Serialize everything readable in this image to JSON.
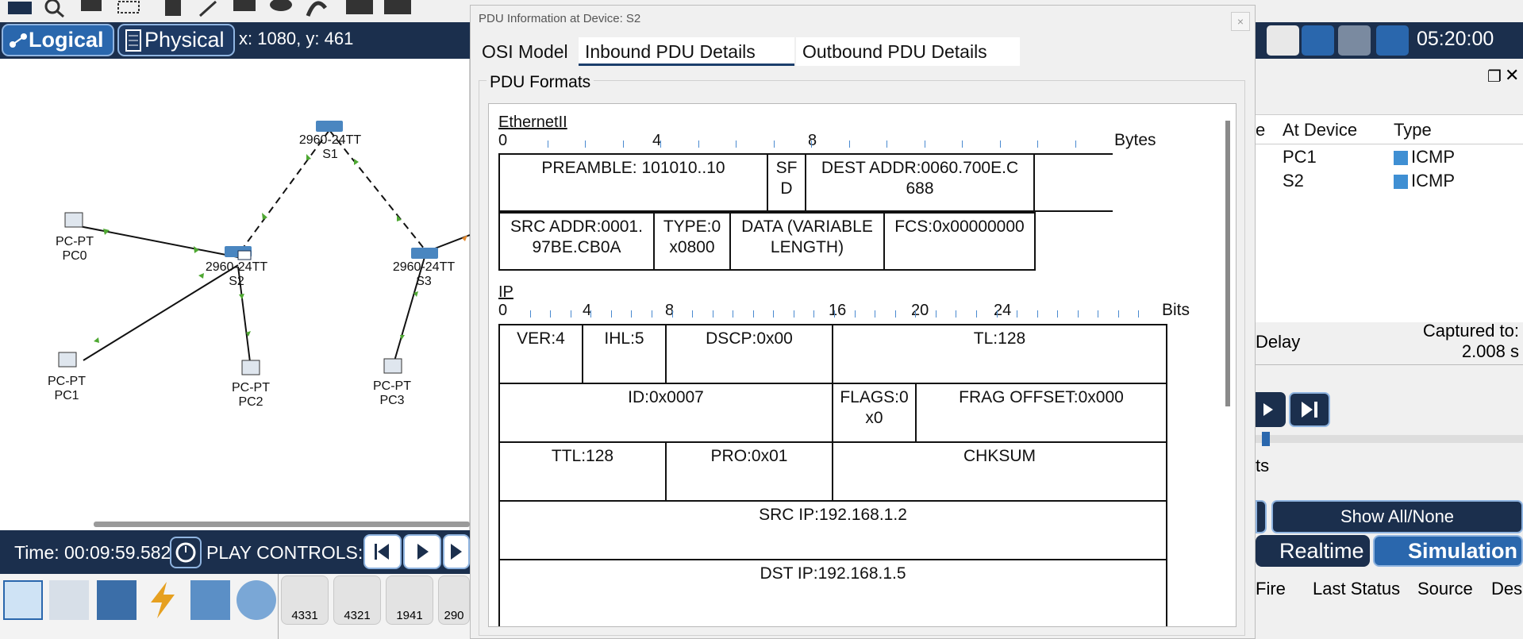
{
  "topbar": {
    "logical_label": "Logical",
    "physical_label": "Physical",
    "coords": "x: 1080, y: 461",
    "clock": "05:20:00"
  },
  "topology": {
    "devices": [
      {
        "model": "2960-24TT",
        "name": "S1"
      },
      {
        "model": "2960-24TT",
        "name": "S2"
      },
      {
        "model": "2960-24TT",
        "name": "S3"
      },
      {
        "model": "PC-PT",
        "name": "PC0"
      },
      {
        "model": "PC-PT",
        "name": "PC1"
      },
      {
        "model": "PC-PT",
        "name": "PC2"
      },
      {
        "model": "PC-PT",
        "name": "PC3"
      }
    ]
  },
  "bottom": {
    "time": "Time: 00:09:59.582",
    "play_controls": "PLAY CONTROLS:",
    "device_tiles": [
      "4331",
      "4321",
      "1941",
      "290"
    ]
  },
  "event_panel": {
    "headers": {
      "partial": "e",
      "at_device": "At Device",
      "type": "Type"
    },
    "rows": [
      {
        "at_device": "PC1",
        "type": "ICMP"
      },
      {
        "at_device": "S2",
        "type": "ICMP"
      }
    ],
    "delay_label": "Delay",
    "captured_label": "Captured to:",
    "captured_value": "2.008 s",
    "events_partial": "ts",
    "show_all_label": "Show All/None",
    "realtime_label": "Realtime",
    "simulation_label": "Simulation",
    "table_headers": [
      "Fire",
      "Last Status",
      "Source",
      "Des"
    ],
    "accent": "#3f8fd3"
  },
  "dialog": {
    "title": "PDU Information at Device: S2",
    "close": "×",
    "tabs": [
      "OSI Model",
      "Inbound PDU Details",
      "Outbound PDU Details"
    ],
    "group_label": "PDU Formats",
    "ethernet": {
      "title": "EthernetII",
      "scale": [
        "0",
        "4",
        "8"
      ],
      "unit": "Bytes",
      "fields": {
        "preamble": "PREAMBLE: 101010..10",
        "sfd": "SF D",
        "dest": "DEST ADDR:0060.700E.C 688",
        "src": "SRC ADDR:0001. 97BE.CB0A",
        "type": "TYPE:0 x0800",
        "data": "DATA (VARIABLE LENGTH)",
        "fcs": "FCS:0x00000000"
      }
    },
    "ip": {
      "title": "IP",
      "scale": [
        "0",
        "4",
        "8",
        "16",
        "20",
        "24"
      ],
      "unit": "Bits",
      "fields": {
        "ver": "VER:4",
        "ihl": "IHL:5",
        "dscp": "DSCP:0x00",
        "tl": "TL:128",
        "id": "ID:0x0007",
        "flags": "FLAGS:0 x0",
        "frag": "FRAG OFFSET:0x000",
        "ttl": "TTL:128",
        "pro": "PRO:0x01",
        "chksum": "CHKSUM",
        "src_ip": "SRC IP:192.168.1.2",
        "dst_ip": "DST IP:192.168.1.5"
      }
    }
  }
}
